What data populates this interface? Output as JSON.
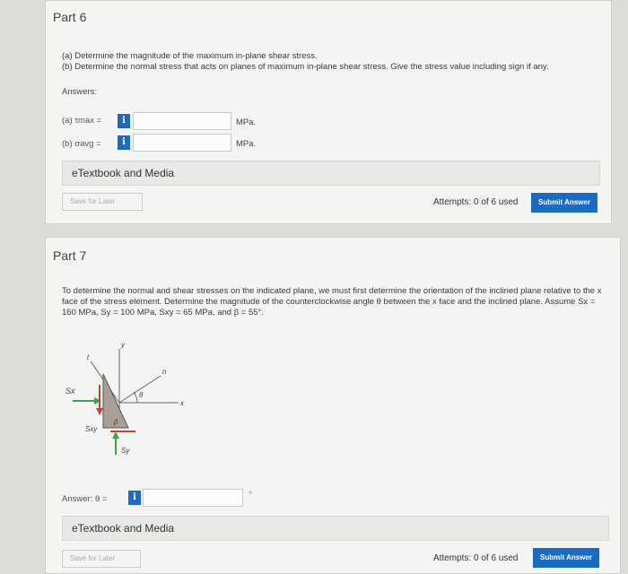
{
  "part6": {
    "title": "Part 6",
    "q_a": "(a) Determine the magnitude of the maximum in-plane shear stress.",
    "q_b": "(b) Determine the normal stress that acts on planes of maximum in-plane shear stress. Give the stress value including sign if any.",
    "answers_label": "Answers:",
    "row_a_label": "(a) τmax  =",
    "row_b_label": "(b) σavg  =",
    "unit_a": "MPa.",
    "unit_b": "MPa.",
    "etextbook": "eTextbook and Media",
    "save_later": "Save for Later",
    "attempts": "Attempts: 0 of 6 used",
    "submit": "Submit Answer"
  },
  "part7": {
    "title": "Part 7",
    "problem": "To determine the normal and shear stresses on the indicated plane, we must first determine the orientation of the inclined plane relative to the x face of the stress element. Determine the magnitude of the counterclockwise angle θ between the x face and the inclined plane. Assume Sx = 160 MPa, Sy = 100 MPa, Sxy = 65 MPa, and β = 55°.",
    "answer_label": "Answer: θ =",
    "unit": "°",
    "etextbook": "eTextbook and Media",
    "save_later": "Save for Later",
    "attempts": "Attempts: 0 of 6 used",
    "submit": "Submit Answer",
    "figure": {
      "label_y": "y",
      "label_t": "t",
      "label_n": "n",
      "label_x": "x",
      "label_theta": "θ",
      "label_beta": "β",
      "label_sx": "Sx",
      "label_sxy": "Sxy",
      "label_sy": "Sy"
    }
  },
  "colors": {
    "info_blue": "#1b6ac4",
    "arrow_green": "#3aa64a",
    "arrow_red": "#d83a3a",
    "element_fill": "#a99f94"
  },
  "icons": {
    "info": "info-icon"
  }
}
